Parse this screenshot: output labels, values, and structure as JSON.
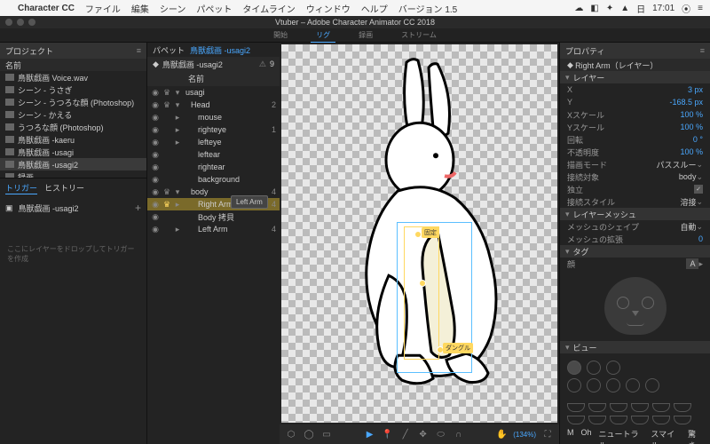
{
  "menubar": {
    "apple": "",
    "app": "Character CC",
    "items": [
      "ファイル",
      "編集",
      "シーン",
      "パペット",
      "タイムライン",
      "ウィンドウ",
      "ヘルプ",
      "バージョン 1.5"
    ],
    "right": {
      "time": "17:01"
    }
  },
  "window": {
    "title": "Vtuber – Adobe Character Animator CC 2018"
  },
  "workspaceTabs": {
    "items": [
      "開始",
      "リグ",
      "録画",
      "ストリーム"
    ],
    "activeIndex": 1
  },
  "project": {
    "title": "プロジェクト",
    "nameHeader": "名前",
    "items": [
      {
        "label": "鳥獣戯画 Voice.wav",
        "icon": "audio"
      },
      {
        "label": "シーン - うさぎ",
        "icon": "scene"
      },
      {
        "label": "シーン - うつろな顔 (Photoshop)",
        "icon": "scene"
      },
      {
        "label": "シーン - かえる",
        "icon": "scene"
      },
      {
        "label": "うつろな顔 (Photoshop)",
        "icon": "puppet"
      },
      {
        "label": "鳥獣戯画 -kaeru",
        "icon": "puppet"
      },
      {
        "label": "鳥獣戯画 -usagi",
        "icon": "puppet"
      },
      {
        "label": "鳥獣戯画 -usagi2",
        "icon": "puppet",
        "selected": true
      },
      {
        "label": "録画",
        "icon": "folder"
      }
    ]
  },
  "triggers": {
    "tabs": [
      "トリガー",
      "ヒストリー"
    ],
    "row": "鳥獣戯画 -usagi2",
    "hint": "ここにレイヤーをドロップしてトリガーを作成"
  },
  "puppetPanel": {
    "breadcrumb": [
      "パペット",
      "鳥獣戯画 -usagi2"
    ],
    "title": "鳥獣戯画 -usagi2",
    "warnCount": "9",
    "listHeader": "名前",
    "layers": [
      {
        "d": 0,
        "eye": true,
        "crown": true,
        "arr": "▾",
        "name": "usagi",
        "num": ""
      },
      {
        "d": 1,
        "eye": true,
        "crown": true,
        "arr": "▾",
        "name": "Head",
        "num": "2"
      },
      {
        "d": 2,
        "eye": true,
        "crown": false,
        "arr": "▸",
        "name": "mouse",
        "num": ""
      },
      {
        "d": 2,
        "eye": true,
        "crown": false,
        "arr": "▸",
        "name": "righteye",
        "num": "1"
      },
      {
        "d": 2,
        "eye": true,
        "crown": false,
        "arr": "▸",
        "name": "lefteye",
        "num": ""
      },
      {
        "d": 2,
        "eye": true,
        "crown": false,
        "arr": "",
        "name": "leftear",
        "num": ""
      },
      {
        "d": 2,
        "eye": true,
        "crown": false,
        "arr": "",
        "name": "rightear",
        "num": ""
      },
      {
        "d": 2,
        "eye": true,
        "crown": false,
        "arr": "",
        "name": "background",
        "num": ""
      },
      {
        "d": 1,
        "eye": true,
        "crown": true,
        "arr": "▾",
        "name": "body",
        "num": "4"
      },
      {
        "d": 2,
        "eye": true,
        "crown": true,
        "arr": "▸",
        "name": "Right Arm",
        "num": "4",
        "selected": true
      },
      {
        "d": 2,
        "eye": true,
        "crown": false,
        "arr": "",
        "name": "Body 拷貝",
        "num": ""
      },
      {
        "d": 2,
        "eye": true,
        "crown": false,
        "arr": "▸",
        "name": "Left Arm",
        "num": "4"
      }
    ],
    "tooltip": "Left Arm"
  },
  "canvas": {
    "zoom": "(134%)",
    "tagTop": "固定",
    "tagBottom": "ダングル"
  },
  "properties": {
    "title": "プロパティ",
    "target": "Right Arm（レイヤー）",
    "layerSection": "レイヤー",
    "rows": [
      {
        "lbl": "X",
        "val": "3 px"
      },
      {
        "lbl": "Y",
        "val": "-168.5 px"
      },
      {
        "lbl": "Xスケール",
        "val": "100 %"
      },
      {
        "lbl": "Yスケール",
        "val": "100 %"
      },
      {
        "lbl": "回転",
        "val": "0 °"
      },
      {
        "lbl": "不透明度",
        "val": "100 %"
      }
    ],
    "blend": {
      "lbl": "描画モード",
      "val": "パススルー"
    },
    "attach": {
      "lbl": "接続対象",
      "val": "body"
    },
    "independent": {
      "lbl": "独立",
      "checked": true
    },
    "attachStyle": {
      "lbl": "接続スタイル",
      "val": "溶接"
    },
    "meshSection": "レイヤーメッシュ",
    "meshShape": {
      "lbl": "メッシュのシェイプ",
      "val": "自動"
    },
    "meshExt": {
      "lbl": "メッシュの拡張",
      "val": "0"
    },
    "tagSection": "タグ",
    "tagHeader": "顔",
    "tagVal": "A",
    "viewSection": "ビュー",
    "mouthLabels": [
      "M",
      "Oh",
      "ニュートラル",
      "スマイル",
      "驚き"
    ]
  }
}
